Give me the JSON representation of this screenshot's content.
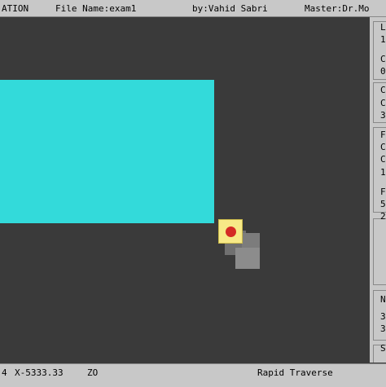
{
  "header": {
    "app_title": "ATION",
    "file_name": "File Name:exam1",
    "author": "by:Vahid Sabri",
    "master": "Master:Dr.Mo"
  },
  "right_panel": {
    "rows": [
      "L",
      "1",
      "C",
      "0",
      "C",
      "C",
      "3",
      "F",
      "C",
      "C",
      "1",
      "F",
      "5",
      "2",
      "Ne",
      "3",
      "3",
      "Sp"
    ]
  },
  "status": {
    "num": "4",
    "x": "X-5333.33",
    "z": "ZO",
    "mode": "Rapid Traverse"
  },
  "colors": {
    "workpiece": "#33dada",
    "tool": "#f7e987",
    "tool_tip": "#d42a24",
    "background": "#3a3a3a"
  }
}
